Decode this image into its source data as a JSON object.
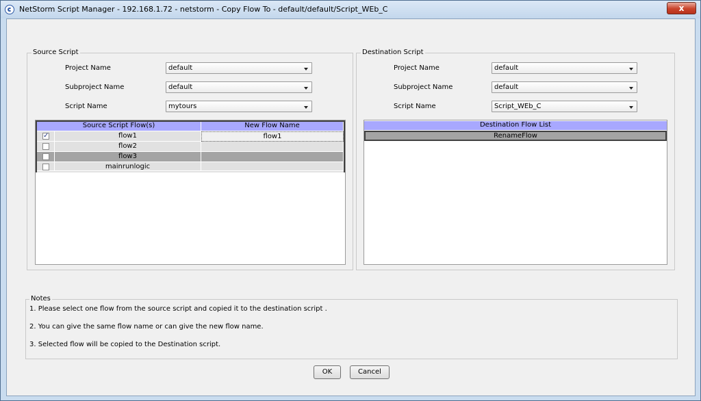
{
  "window": {
    "title": "NetStorm  Script Manager - 192.168.1.72 - netstorm - Copy Flow To - default/default/Script_WEb_C",
    "close_label": "x"
  },
  "source": {
    "legend": "Source Script",
    "project_label": "Project Name",
    "project_value": "default",
    "subproject_label": "Subproject Name",
    "subproject_value": "default",
    "script_label": "Script Name",
    "script_value": "mytours",
    "table": {
      "headers": [
        "Source Script Flow(s)",
        "New Flow Name"
      ],
      "rows": [
        {
          "checked": true,
          "flow": "flow1",
          "new_name": "flow1"
        },
        {
          "checked": false,
          "flow": "flow2",
          "new_name": ""
        },
        {
          "checked": false,
          "flow": "flow3",
          "new_name": ""
        },
        {
          "checked": false,
          "flow": "mainrunlogic",
          "new_name": ""
        }
      ]
    }
  },
  "destination": {
    "legend": "Destination Script",
    "project_label": "Project Name",
    "project_value": "default",
    "subproject_label": "Subproject Name",
    "subproject_value": "default",
    "script_label": "Script Name",
    "script_value": "Script_WEb_C",
    "table": {
      "header": "Destination Flow List",
      "rows": [
        "RenameFlow"
      ]
    }
  },
  "notes": {
    "legend": "Notes",
    "lines": [
      "1. Please select one flow from the source script and copied it to the destination script .",
      "2. You can give the same flow name or can give the new flow name.",
      "3. Selected flow will be copied to the Destination script."
    ]
  },
  "buttons": {
    "ok": "OK",
    "cancel": "Cancel"
  }
}
